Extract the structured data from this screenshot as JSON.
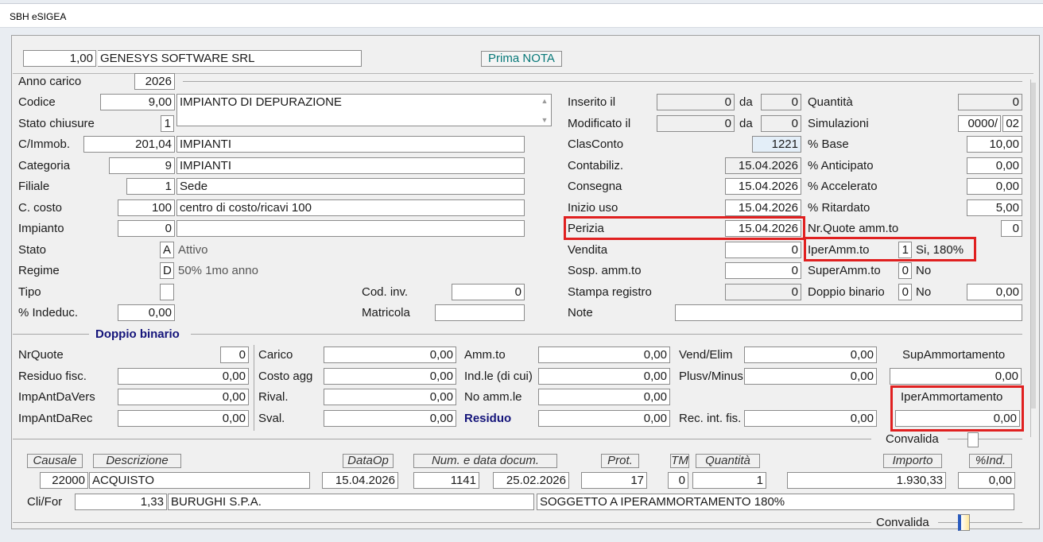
{
  "window": {
    "title": "SBH eSIGEA"
  },
  "company": {
    "code": "1,00",
    "name": "GENESYS SOFTWARE SRL",
    "mode_button": "Prima NOTA"
  },
  "left": {
    "anno_carico": {
      "label": "Anno carico",
      "value": "2026"
    },
    "codice": {
      "label": "Codice",
      "value": "9,00",
      "desc": "IMPIANTO DI DEPURAZIONE"
    },
    "stato_chiusure": {
      "label": "Stato chiusure",
      "value": "1"
    },
    "cimmob": {
      "label": "C/Immob.",
      "value": "201,04",
      "desc": "IMPIANTI"
    },
    "categoria": {
      "label": "Categoria",
      "value": "9",
      "desc": "IMPIANTI"
    },
    "filiale": {
      "label": "Filiale",
      "value": "1",
      "desc": "Sede"
    },
    "ccosto": {
      "label": "C. costo",
      "value": "100",
      "desc": "centro di costo/ricavi 100"
    },
    "impianto": {
      "label": "Impianto",
      "value": "0",
      "desc": ""
    },
    "stato": {
      "label": "Stato",
      "value": "A",
      "desc": "Attivo"
    },
    "regime": {
      "label": "Regime",
      "value": "D",
      "desc": "50% 1mo anno"
    },
    "tipo": {
      "label": "Tipo",
      "value": ""
    },
    "indeduc": {
      "label": "% Indeduc.",
      "value": "0,00"
    },
    "cod_inv": {
      "label": "Cod. inv.",
      "value": "0"
    },
    "matricola": {
      "label": "Matricola",
      "value": ""
    }
  },
  "mid": {
    "inserito": {
      "label": "Inserito il",
      "value": "0",
      "da_label": "da",
      "da": "0"
    },
    "modificato": {
      "label": "Modificato il",
      "value": "0",
      "da_label": "da",
      "da": "0"
    },
    "clasconto": {
      "label": "ClasConto",
      "value": "1221"
    },
    "contabiliz": {
      "label": "Contabiliz.",
      "value": "15.04.2026"
    },
    "consegna": {
      "label": "Consegna",
      "value": "15.04.2026"
    },
    "inizio_uso": {
      "label": "Inizio uso",
      "value": "15.04.2026"
    },
    "perizia": {
      "label": "Perizia",
      "value": "15.04.2026"
    },
    "vendita": {
      "label": "Vendita",
      "value": "0"
    },
    "sosp": {
      "label": "Sosp. amm.to",
      "value": "0"
    },
    "stampa": {
      "label": "Stampa registro",
      "value": "0"
    },
    "note": {
      "label": "Note",
      "value": ""
    }
  },
  "right": {
    "quantita": {
      "label": "Quantità",
      "value": "0"
    },
    "simulazioni": {
      "label": "Simulazioni",
      "value1": "0000/",
      "value2": "02"
    },
    "base": {
      "label": "% Base",
      "value": "10,00"
    },
    "anticipato": {
      "label": "% Anticipato",
      "value": "0,00"
    },
    "accelerato": {
      "label": "% Accelerato",
      "value": "0,00"
    },
    "ritardato": {
      "label": "% Ritardato",
      "value": "5,00"
    },
    "nrquote": {
      "label": "Nr.Quote amm.to",
      "value": "0"
    },
    "iperamm": {
      "label": "IperAmm.to",
      "value": "1",
      "desc": "Si, 180%"
    },
    "superamm": {
      "label": "SuperAmm.to",
      "value": "0",
      "desc": "No"
    },
    "doppio": {
      "label": "Doppio binario",
      "value": "0",
      "desc": "No",
      "amount": "0,00"
    }
  },
  "doppio_binario": {
    "title": "Doppio binario",
    "nrquote": {
      "label": "NrQuote",
      "value": "0"
    },
    "residuo_fisc": {
      "label": "Residuo fisc.",
      "value": "0,00"
    },
    "impantdavers": {
      "label": "ImpAntDaVers",
      "value": "0,00"
    },
    "impantdarec": {
      "label": "ImpAntDaRec",
      "value": "0,00"
    },
    "carico": {
      "label": "Carico",
      "value": "0,00"
    },
    "costo_agg": {
      "label": "Costo agg",
      "value": "0,00"
    },
    "rival": {
      "label": "Rival.",
      "value": "0,00"
    },
    "sval": {
      "label": "Sval.",
      "value": "0,00"
    },
    "ammto": {
      "label": "Amm.to",
      "value": "0,00"
    },
    "indle": {
      "label": "Ind.le (di cui)",
      "value": "0,00"
    },
    "noammle": {
      "label": "No amm.le",
      "value": "0,00"
    },
    "residuo": {
      "label": "Residuo",
      "value": "0,00"
    },
    "vendelim": {
      "label": "Vend/Elim",
      "value": "0,00"
    },
    "plusv": {
      "label": "Plusv/Minus",
      "value": "0,00"
    },
    "recint": {
      "label": "Rec. int. fis.",
      "value": "0,00"
    },
    "supamm": {
      "label": "SupAmmortamento",
      "value": "0,00"
    },
    "iperammort": {
      "label": "IperAmmortamento",
      "value": "0,00"
    },
    "convalida": "Convalida"
  },
  "movement": {
    "headers": {
      "causale": "Causale",
      "descrizione": "Descrizione",
      "dataop": "DataOp",
      "numdoc": "Num. e data docum.",
      "prot": "Prot.",
      "tm": "TM",
      "quantita": "Quantità",
      "importo": "Importo",
      "ind": "%Ind."
    },
    "row": {
      "causale": "22000",
      "descrizione": "ACQUISTO",
      "dataop": "15.04.2026",
      "num": "1141",
      "data": "25.02.2026",
      "prot": "17",
      "tm": "0",
      "quantita": "1",
      "importo": "1.930,33",
      "ind": "0,00"
    },
    "clifor": {
      "label": "Cli/For",
      "code": "1,33",
      "name": "BURUGHI S.P.A.",
      "note": "SOGGETTO A IPERAMMORTAMENTO 180%"
    },
    "convalida": "Convalida"
  },
  "colors": {
    "highlight": "#e02020",
    "section_title": "#14147a",
    "mode_button_text": "#087878"
  }
}
